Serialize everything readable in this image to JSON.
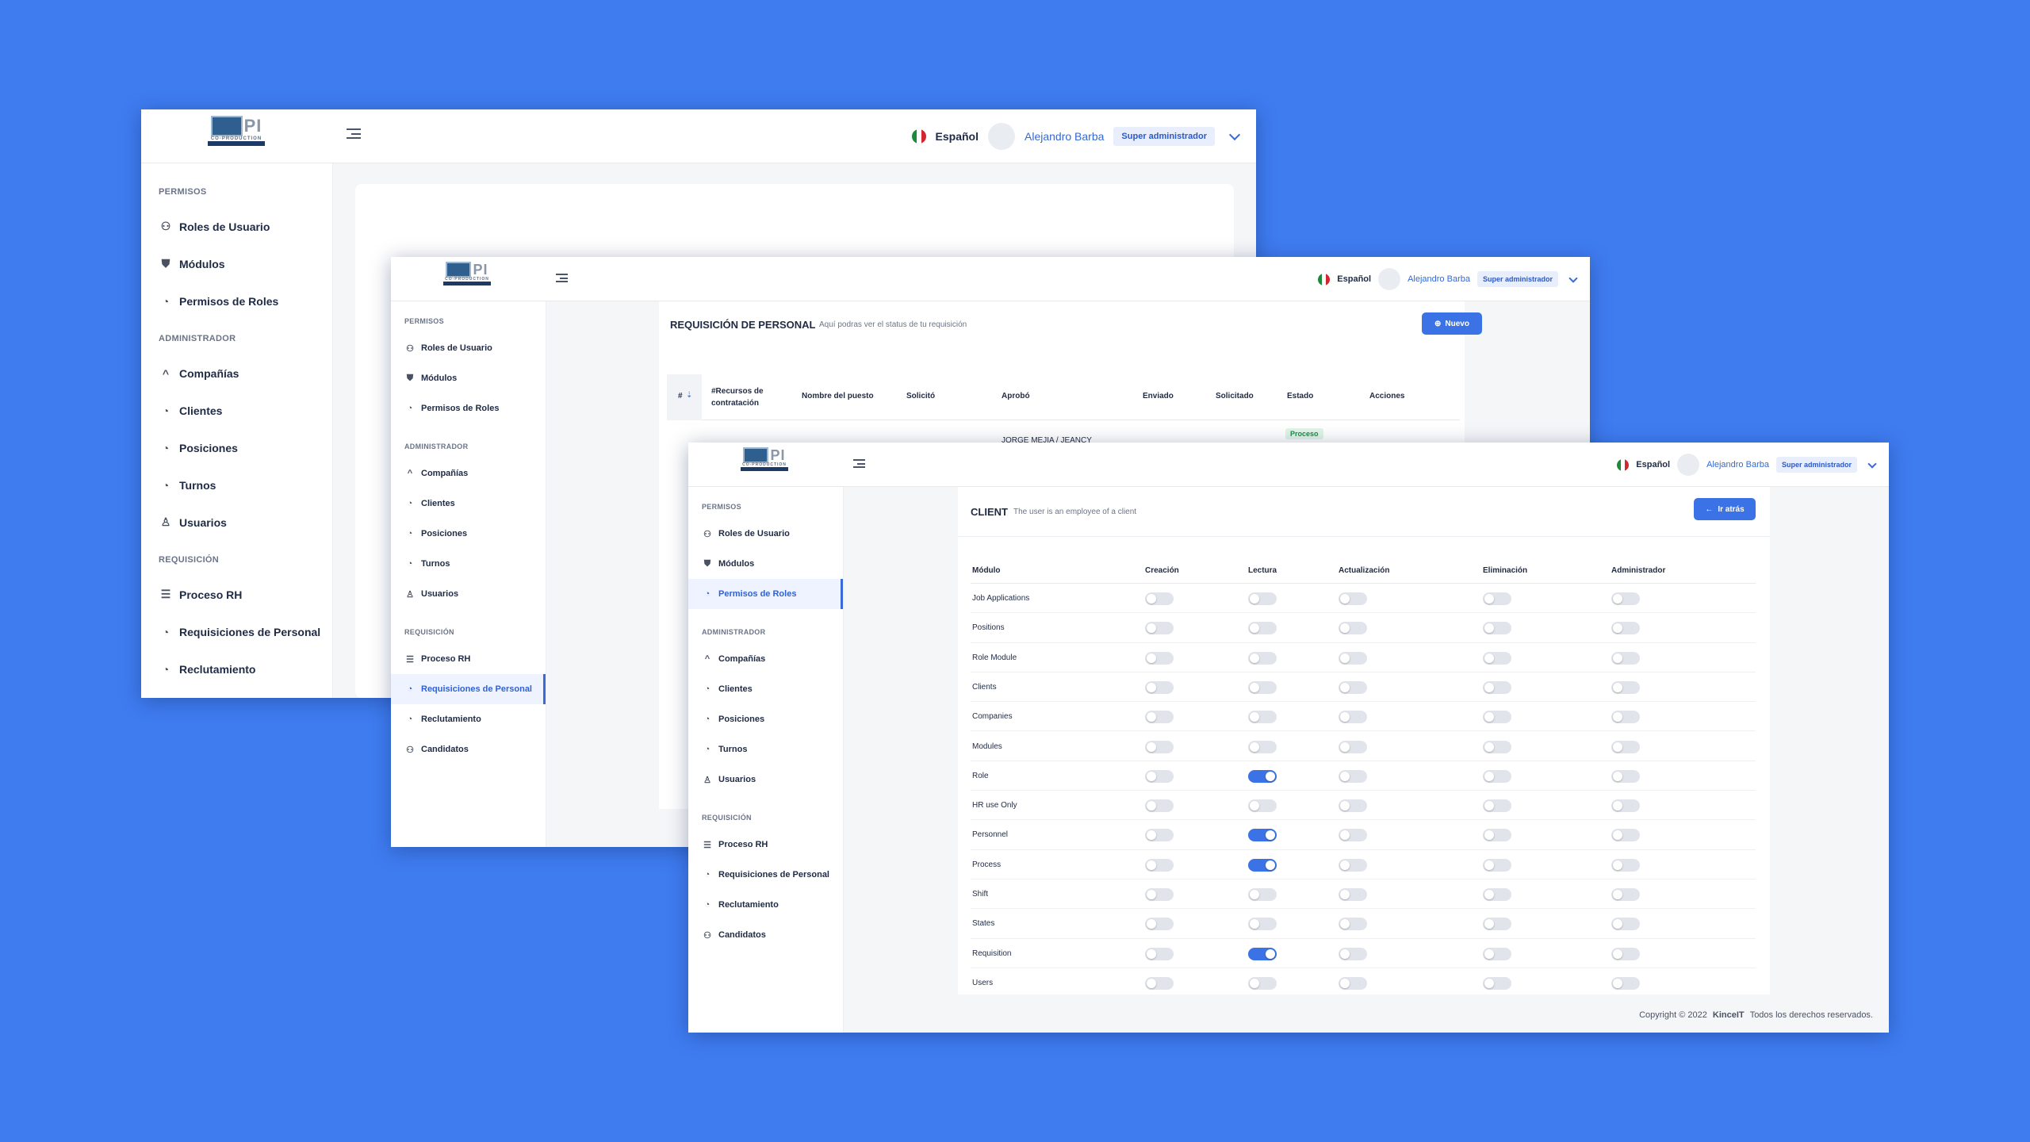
{
  "app": {
    "logo_text": "CO-PRODUCTION",
    "logo_sub": "INTERNATIONAL",
    "language": "Español",
    "user_name": "Alejandro Barba",
    "user_role": "Super administrador"
  },
  "nav": {
    "sections": [
      {
        "title": "PERMISOS",
        "items": [
          {
            "label": "Roles de Usuario",
            "icon": "users-icon"
          },
          {
            "label": "Módulos",
            "icon": "shield-icon"
          },
          {
            "label": "Permisos de Roles",
            "icon": "gauge-icon"
          }
        ]
      },
      {
        "title": "ADMINISTRADOR",
        "items": [
          {
            "label": "Compañías",
            "icon": "chevron-up-icon"
          },
          {
            "label": "Clientes",
            "icon": "gauge-icon"
          },
          {
            "label": "Posiciones",
            "icon": "gauge-icon"
          },
          {
            "label": "Turnos",
            "icon": "gauge-icon"
          },
          {
            "label": "Usuarios",
            "icon": "user-icon"
          }
        ]
      },
      {
        "title": "REQUISICIÓN",
        "items": [
          {
            "label": "Proceso RH",
            "icon": "list-icon"
          },
          {
            "label": "Requisiciones de Personal",
            "icon": "gauge-icon"
          },
          {
            "label": "Reclutamiento",
            "icon": "gauge-icon"
          },
          {
            "label": "Candidatos",
            "icon": "users-icon"
          }
        ]
      }
    ]
  },
  "window2": {
    "title": "REQUISICIÓN DE PERSONAL",
    "subtitle": "Aquí podras ver el status de tu requisición",
    "new_button": "Nuevo",
    "columns": [
      "#",
      "#Recursos de contratación",
      "Nombre del puesto",
      "Solicitó",
      "Aprobó",
      "Enviado",
      "Solicitado",
      "Estado",
      "Acciones"
    ],
    "first_row": {
      "aprobo": "JORGE MEJIA / JEANCY",
      "estado": "Proceso"
    }
  },
  "window3": {
    "title": "CLIENT",
    "subtitle": "The user is an employee of a client",
    "back_button": "Ir atrás",
    "columns": [
      "Módulo",
      "Creación",
      "Lectura",
      "Actualización",
      "Eliminación",
      "Administrador"
    ],
    "rows": [
      {
        "module": "Job Applications",
        "perms": [
          false,
          false,
          false,
          false,
          false
        ]
      },
      {
        "module": "Positions",
        "perms": [
          false,
          false,
          false,
          false,
          false
        ]
      },
      {
        "module": "Role Module",
        "perms": [
          false,
          false,
          false,
          false,
          false
        ]
      },
      {
        "module": "Clients",
        "perms": [
          false,
          false,
          false,
          false,
          false
        ]
      },
      {
        "module": "Companies",
        "perms": [
          false,
          false,
          false,
          false,
          false
        ]
      },
      {
        "module": "Modules",
        "perms": [
          false,
          false,
          false,
          false,
          false
        ]
      },
      {
        "module": "Role",
        "perms": [
          false,
          true,
          false,
          false,
          false
        ]
      },
      {
        "module": "HR use Only",
        "perms": [
          false,
          false,
          false,
          false,
          false
        ]
      },
      {
        "module": "Personnel",
        "perms": [
          false,
          true,
          false,
          false,
          false
        ]
      },
      {
        "module": "Process",
        "perms": [
          false,
          true,
          false,
          false,
          false
        ]
      },
      {
        "module": "Shift",
        "perms": [
          false,
          false,
          false,
          false,
          false
        ]
      },
      {
        "module": "States",
        "perms": [
          false,
          false,
          false,
          false,
          false
        ]
      },
      {
        "module": "Requisition",
        "perms": [
          false,
          true,
          false,
          false,
          false
        ]
      },
      {
        "module": "Users",
        "perms": [
          false,
          false,
          false,
          false,
          false
        ]
      }
    ],
    "footer_prefix": "Copyright © 2022",
    "footer_brand": "KinceIT",
    "footer_suffix": "Todos los derechos reservados."
  },
  "colors": {
    "background": "#3f7cf0",
    "accent": "#3b73e6",
    "toggle_off": "#e1e4ea"
  }
}
